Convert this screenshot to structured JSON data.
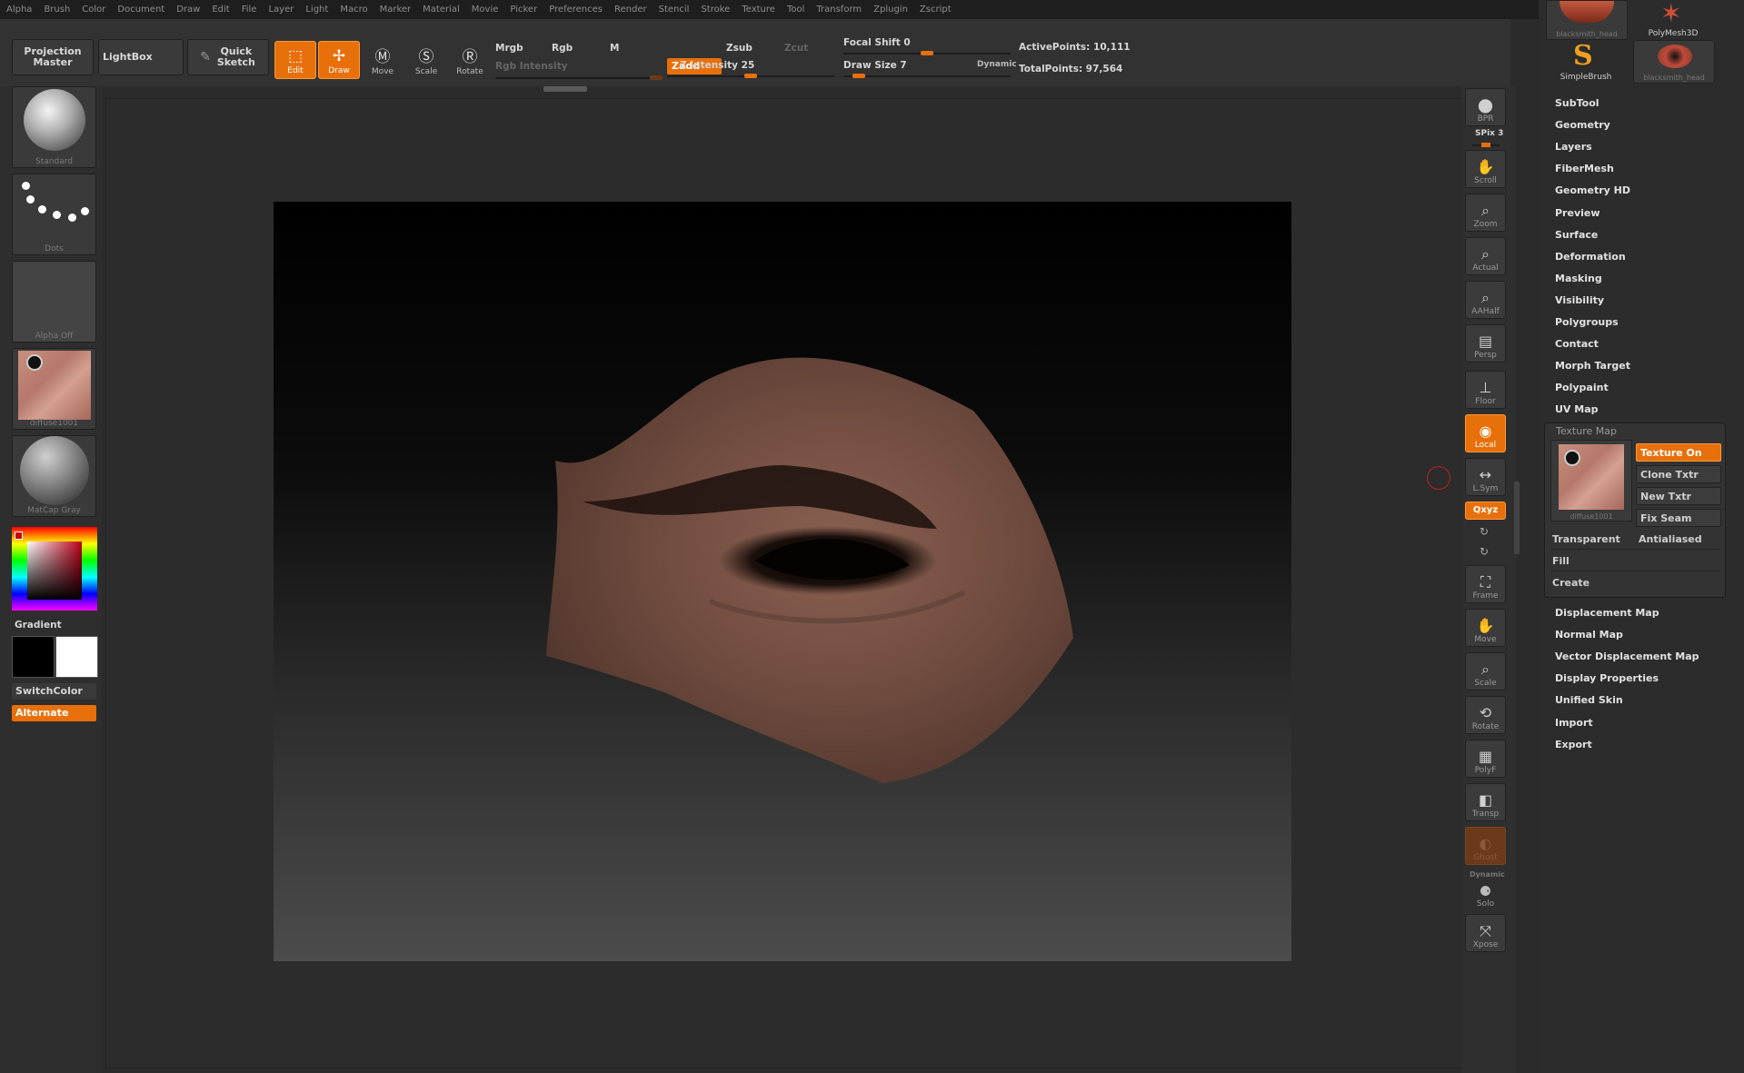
{
  "menubar": [
    "Alpha",
    "Brush",
    "Color",
    "Document",
    "Draw",
    "Edit",
    "File",
    "Layer",
    "Light",
    "Macro",
    "Marker",
    "Material",
    "Movie",
    "Picker",
    "Preferences",
    "Render",
    "Stencil",
    "Stroke",
    "Texture",
    "Tool",
    "Transform",
    "Zplugin",
    "Zscript"
  ],
  "toolbar": {
    "projection_master": "Projection Master",
    "lightbox": "LightBox",
    "quick_sketch": "Quick Sketch",
    "edit": "Edit",
    "draw": "Draw",
    "move": "Move",
    "scale": "Scale",
    "rotate": "Rotate",
    "mrgb": "Mrgb",
    "rgb": "Rgb",
    "m": "M",
    "rgb_intensity": "Rgb Intensity",
    "zadd": "Zadd",
    "zsub": "Zsub",
    "zcut": "Zcut",
    "z_intensity": "Z Intensity 25",
    "focal_shift": "Focal Shift 0",
    "draw_size": "Draw Size 7",
    "dynamic": "Dynamic",
    "active_points": "ActivePoints: 10,111",
    "total_points": "TotalPoints: 97,564"
  },
  "left": {
    "standard": "Standard",
    "dots": "Dots",
    "alpha_off": "Alpha Off",
    "texture": "diffuse1001",
    "matcap": "MatCap Gray",
    "gradient": "Gradient",
    "switch_color": "SwitchColor",
    "alternate": "Alternate",
    "primary_color": "#000000",
    "secondary_color": "#ffffff"
  },
  "right_tools": {
    "bpr": "BPR",
    "spix": "SPix 3",
    "scroll": "Scroll",
    "zoom": "Zoom",
    "actual": "Actual",
    "aahalf": "AAHalf",
    "persp": "Persp",
    "floor": "Floor",
    "local": "Local",
    "lsym": "L.Sym",
    "xyz": "Qxyz",
    "frame": "Frame",
    "move": "Move",
    "scale": "Scale",
    "rotate": "Rotate",
    "polyf": "PolyF",
    "transp": "Transp",
    "ghost": "Ghost",
    "dynamic": "Dynamic",
    "solo": "Solo",
    "xpose": "Xpose"
  },
  "palette": {
    "tools": [
      {
        "label": "blacksmith_head"
      },
      {
        "label": "PolyMesh3D"
      },
      {
        "label": "SimpleBrush"
      },
      {
        "label": "blacksmith_head"
      }
    ],
    "menu_top": [
      "SubTool",
      "Geometry",
      "Layers",
      "FiberMesh",
      "Geometry HD",
      "Preview",
      "Surface",
      "Deformation",
      "Masking",
      "Visibility",
      "Polygroups",
      "Contact",
      "Morph Target",
      "Polypaint",
      "UV Map"
    ],
    "texture_map": {
      "title": "Texture Map",
      "thumb_caption": "diffuse1001",
      "texture_on": "Texture On",
      "clone_txtr": "Clone Txtr",
      "new_txtr": "New Txtr",
      "fix_seam": "Fix Seam",
      "transparent": "Transparent",
      "antialiased": "Antialiased",
      "fill": "Fill",
      "create": "Create"
    },
    "menu_bottom": [
      "Displacement Map",
      "Normal Map",
      "Vector Displacement Map",
      "Display Properties",
      "Unified Skin",
      "Import",
      "Export"
    ]
  }
}
